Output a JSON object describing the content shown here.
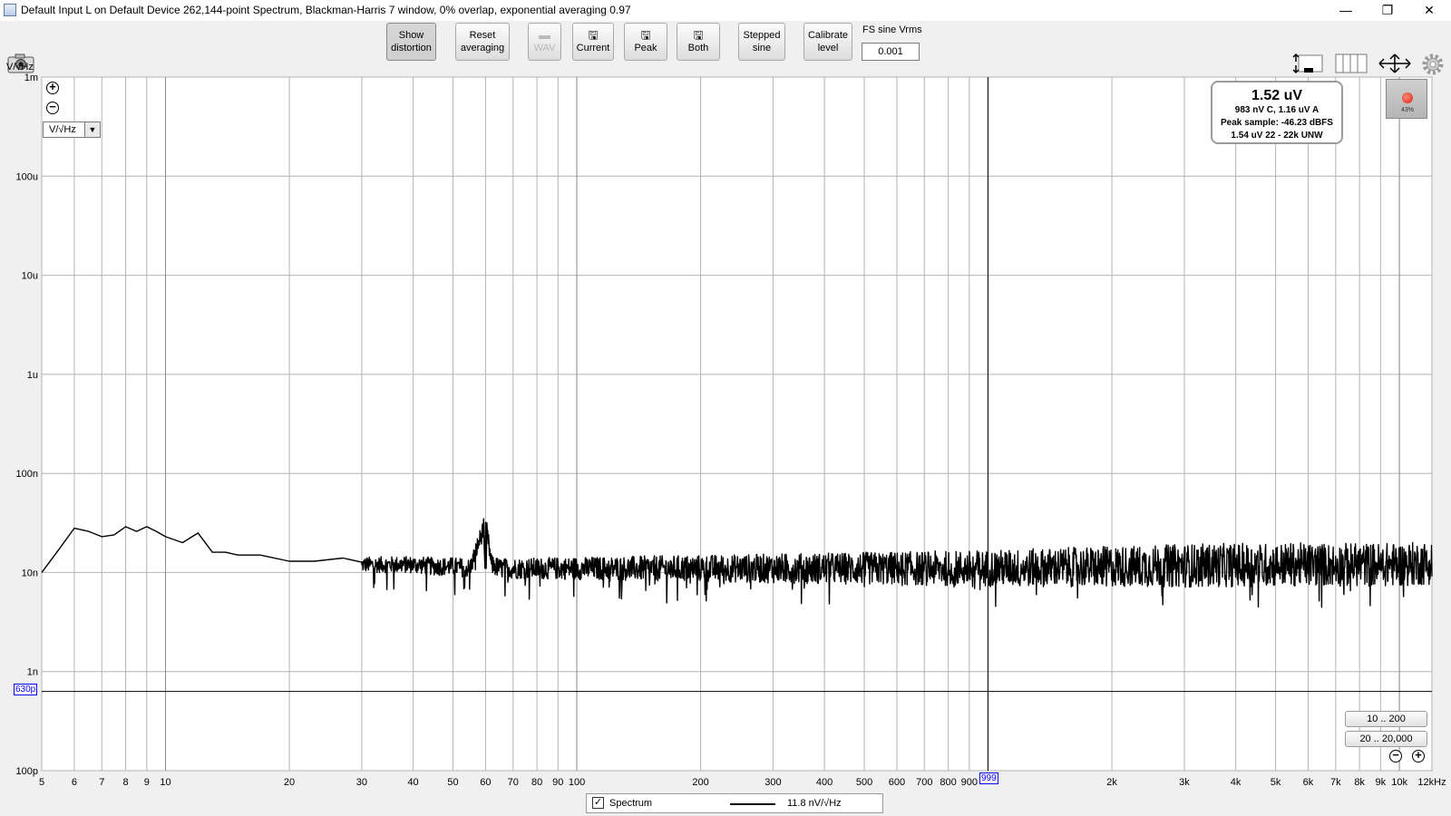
{
  "window": {
    "title": "Default Input L on Default Device 262,144-point Spectrum, Blackman-Harris 7 window, 0% overlap, exponential averaging 0.97",
    "minimize_glyph": "—",
    "restore_glyph": "❐",
    "close_glyph": "✕"
  },
  "toolbar": {
    "show_distortion": [
      "Show",
      "distortion"
    ],
    "reset_averaging": [
      "Reset",
      "averaging"
    ],
    "wav": "WAV",
    "current": "Current",
    "peak": "Peak",
    "both": "Both",
    "stepped_sine": [
      "Stepped",
      "sine"
    ],
    "calibrate_level": [
      "Calibrate",
      "level"
    ],
    "fs_sine_label": "FS sine Vrms",
    "fs_sine_value": "0.001",
    "save_icon": "floppy-disk-icon"
  },
  "plot": {
    "y_unit_label": "V/√Hz",
    "y_unit_selector": "V/√Hz",
    "y_marker_label": "630p",
    "x_marker_label": "999",
    "zoom_in_glyph": "⊕",
    "zoom_out_glyph": "⊖"
  },
  "readout": {
    "main": "1.52 uV",
    "line1": "983 nV C, 1.16 uV A",
    "line2": "Peak sample: -46.23 dBFS",
    "line3": "1.54 uV 22 - 22k UNW"
  },
  "recorder": {
    "percent": "43%"
  },
  "range_buttons": {
    "narrow": "10 .. 200",
    "wide": "20 .. 20,000"
  },
  "legend": {
    "checked": true,
    "check_glyph": "✓",
    "name": "Spectrum",
    "value": "11.8 nV/√Hz"
  },
  "colors": {
    "trace": "#000000",
    "grid": "#b4b4b4",
    "marker": "#0000ff",
    "record": "#d81d0a"
  },
  "chart_data": {
    "type": "line",
    "title": "",
    "xlabel": "",
    "ylabel": "V/√Hz",
    "x_scale": "log",
    "y_scale": "log",
    "xlim": [
      5,
      12000
    ],
    "ylim": [
      1e-10,
      0.001
    ],
    "grid": true,
    "y_ticks": [
      {
        "v": 0.001,
        "label": "1m"
      },
      {
        "v": 0.0001,
        "label": "100u"
      },
      {
        "v": 1e-05,
        "label": "10u"
      },
      {
        "v": 1e-06,
        "label": "1u"
      },
      {
        "v": 1e-07,
        "label": "100n"
      },
      {
        "v": 1e-08,
        "label": "10n"
      },
      {
        "v": 1e-09,
        "label": "1n"
      },
      {
        "v": 1e-10,
        "label": "100p"
      }
    ],
    "x_ticks": [
      {
        "v": 5,
        "label": "5"
      },
      {
        "v": 6,
        "label": "6"
      },
      {
        "v": 7,
        "label": "7"
      },
      {
        "v": 8,
        "label": "8"
      },
      {
        "v": 9,
        "label": "9"
      },
      {
        "v": 10,
        "label": "10"
      },
      {
        "v": 20,
        "label": "20"
      },
      {
        "v": 30,
        "label": "30"
      },
      {
        "v": 40,
        "label": "40"
      },
      {
        "v": 50,
        "label": "50"
      },
      {
        "v": 60,
        "label": "60"
      },
      {
        "v": 70,
        "label": "70"
      },
      {
        "v": 80,
        "label": "80"
      },
      {
        "v": 90,
        "label": "90"
      },
      {
        "v": 100,
        "label": "100"
      },
      {
        "v": 200,
        "label": "200"
      },
      {
        "v": 300,
        "label": "300"
      },
      {
        "v": 400,
        "label": "400"
      },
      {
        "v": 500,
        "label": "500"
      },
      {
        "v": 600,
        "label": "600"
      },
      {
        "v": 700,
        "label": "700"
      },
      {
        "v": 800,
        "label": "800"
      },
      {
        "v": 900,
        "label": "900"
      },
      {
        "v": 2000,
        "label": "2k"
      },
      {
        "v": 3000,
        "label": "3k"
      },
      {
        "v": 4000,
        "label": "4k"
      },
      {
        "v": 5000,
        "label": "5k"
      },
      {
        "v": 6000,
        "label": "6k"
      },
      {
        "v": 7000,
        "label": "7k"
      },
      {
        "v": 8000,
        "label": "8k"
      },
      {
        "v": 9000,
        "label": "9k"
      },
      {
        "v": 10000,
        "label": "10k"
      },
      {
        "v": 12000,
        "label": "12kHz"
      }
    ],
    "cursor": {
      "x": 999,
      "y": 6.3e-10
    },
    "series": [
      {
        "name": "Spectrum",
        "x": [
          5,
          5.5,
          6,
          6.5,
          7,
          7.5,
          8,
          8.5,
          9,
          9.5,
          10,
          11,
          12,
          13,
          14,
          15,
          17,
          20,
          23,
          27,
          30,
          35,
          40,
          45,
          50,
          55,
          60,
          62,
          65,
          70,
          80,
          100,
          200,
          500,
          1000,
          2000,
          5000,
          10000,
          12000
        ],
        "y": [
          1e-08,
          1.7e-08,
          2.8e-08,
          2.6e-08,
          2.3e-08,
          2.4e-08,
          2.9e-08,
          2.6e-08,
          2.9e-08,
          2.6e-08,
          2.3e-08,
          2e-08,
          2.5e-08,
          1.6e-08,
          1.6e-08,
          1.5e-08,
          1.5e-08,
          1.3e-08,
          1.3e-08,
          1.4e-08,
          1.2e-08,
          1.2e-08,
          1.2e-08,
          1.15e-08,
          1.15e-08,
          1.1e-08,
          3.2e-08,
          1.2e-08,
          1.1e-08,
          1.1e-08,
          1.1e-08,
          1.1e-08,
          1.1e-08,
          1.1e-08,
          1.1e-08,
          1.15e-08,
          1.2e-08,
          1.2e-08,
          1.25e-08
        ]
      }
    ]
  }
}
